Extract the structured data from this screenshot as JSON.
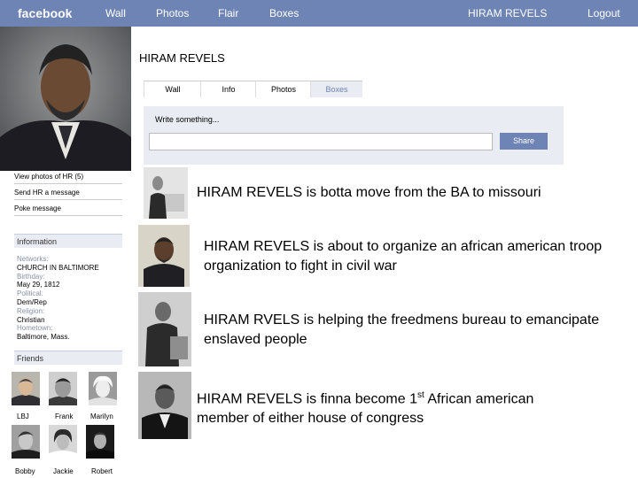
{
  "header": {
    "logo": "facebook",
    "nav": [
      "Wall",
      "Photos",
      "Flair",
      "Boxes"
    ],
    "user_name": "HIRAM REVELS",
    "logout": "Logout"
  },
  "sidebar": {
    "links": [
      "View photos of HR (5)",
      "Send HR a message",
      "Poke message"
    ],
    "info_title": "Information",
    "info": [
      {
        "label": "Networks:",
        "value": "CHURCH IN BALTIMORE"
      },
      {
        "label": "Birthday:",
        "value": "May 29, 1812"
      },
      {
        "label": "Political:",
        "value": "Dem/Rep"
      },
      {
        "label": "Religion:",
        "value": "Christian"
      },
      {
        "label": "Hometown:",
        "value": "Baltimore, Mass."
      }
    ],
    "friends_title": "Friends",
    "friends": [
      "LBJ",
      "Frank",
      "Marilyn",
      "Bobby",
      "Jackie",
      "Robert"
    ]
  },
  "profile": {
    "name": "HIRAM REVELS",
    "tabs": [
      "Wall",
      "Info",
      "Photos",
      "Boxes"
    ],
    "composer_label": "Write something...",
    "composer_value": "",
    "share_label": "Share"
  },
  "posts": [
    {
      "text": "HIRAM REVELS is botta move from the BA to missouri"
    },
    {
      "text": "HIRAM REVELS is about to organize an african american troop organization to fight in civil war"
    },
    {
      "text": "HIRAM RVELS is helping the freedmens bureau to emancipate enslaved people"
    },
    {
      "text_before": "HIRAM REVELS is finna become 1",
      "sup": "st",
      "text_after": " African american member of either house of congress"
    }
  ]
}
